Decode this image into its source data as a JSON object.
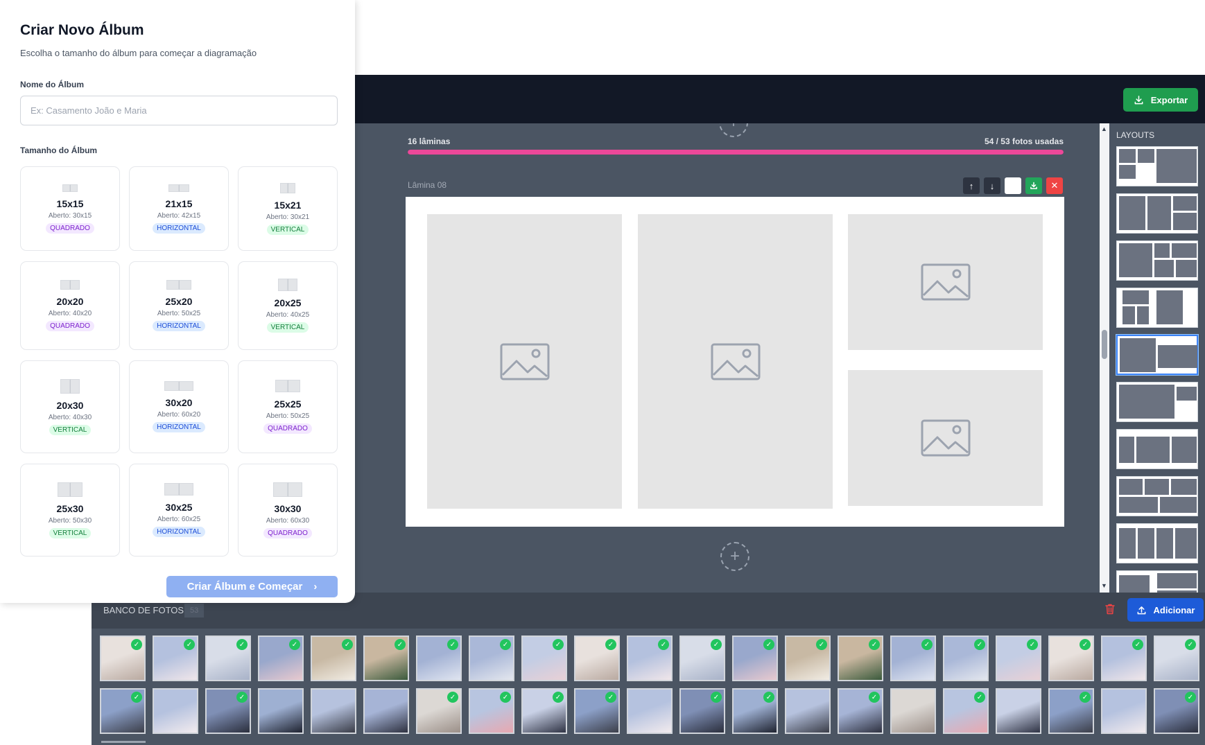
{
  "modal": {
    "title": "Criar Novo Álbum",
    "subtitle": "Escolha o tamanho do álbum para começar a diagramação",
    "name_label": "Nome do Álbum",
    "name_placeholder": "Ex: Casamento João e Maria",
    "name_value": "",
    "size_label": "Tamanho do Álbum",
    "sizes": [
      {
        "name": "15x15",
        "open": "Aberto: 30x15",
        "type": "QUADRADO"
      },
      {
        "name": "21x15",
        "open": "Aberto: 42x15",
        "type": "HORIZONTAL"
      },
      {
        "name": "15x21",
        "open": "Aberto: 30x21",
        "type": "VERTICAL"
      },
      {
        "name": "20x20",
        "open": "Aberto: 40x20",
        "type": "QUADRADO"
      },
      {
        "name": "25x20",
        "open": "Aberto: 50x25",
        "type": "HORIZONTAL"
      },
      {
        "name": "20x25",
        "open": "Aberto: 40x25",
        "type": "VERTICAL"
      },
      {
        "name": "20x30",
        "open": "Aberto: 40x30",
        "type": "VERTICAL"
      },
      {
        "name": "30x20",
        "open": "Aberto: 60x20",
        "type": "HORIZONTAL"
      },
      {
        "name": "25x25",
        "open": "Aberto: 50x25",
        "type": "QUADRADO"
      },
      {
        "name": "25x30",
        "open": "Aberto: 50x30",
        "type": "VERTICAL"
      },
      {
        "name": "30x25",
        "open": "Aberto: 60x25",
        "type": "HORIZONTAL"
      },
      {
        "name": "30x30",
        "open": "Aberto: 60x30",
        "type": "QUADRADO"
      }
    ],
    "create_button": "Criar Álbum e Começar"
  },
  "editor": {
    "export_button": "Exportar",
    "sheets_count": "16 lâminas",
    "photos_used": "54 / 53 fotos usadas",
    "progress_fraction": 1.0,
    "current_sheet": "Lâmina 08",
    "layouts_title": "LAYOUTS",
    "selected_layout_index": 4
  },
  "bank": {
    "title": "BANCO DE FOTOS",
    "count": "53",
    "add_button": "Adicionar"
  },
  "colors": {
    "accent_pink": "#ec4899",
    "export_green": "#1f9d4f",
    "add_blue": "#1d5bd8",
    "check_green": "#22c55e"
  }
}
